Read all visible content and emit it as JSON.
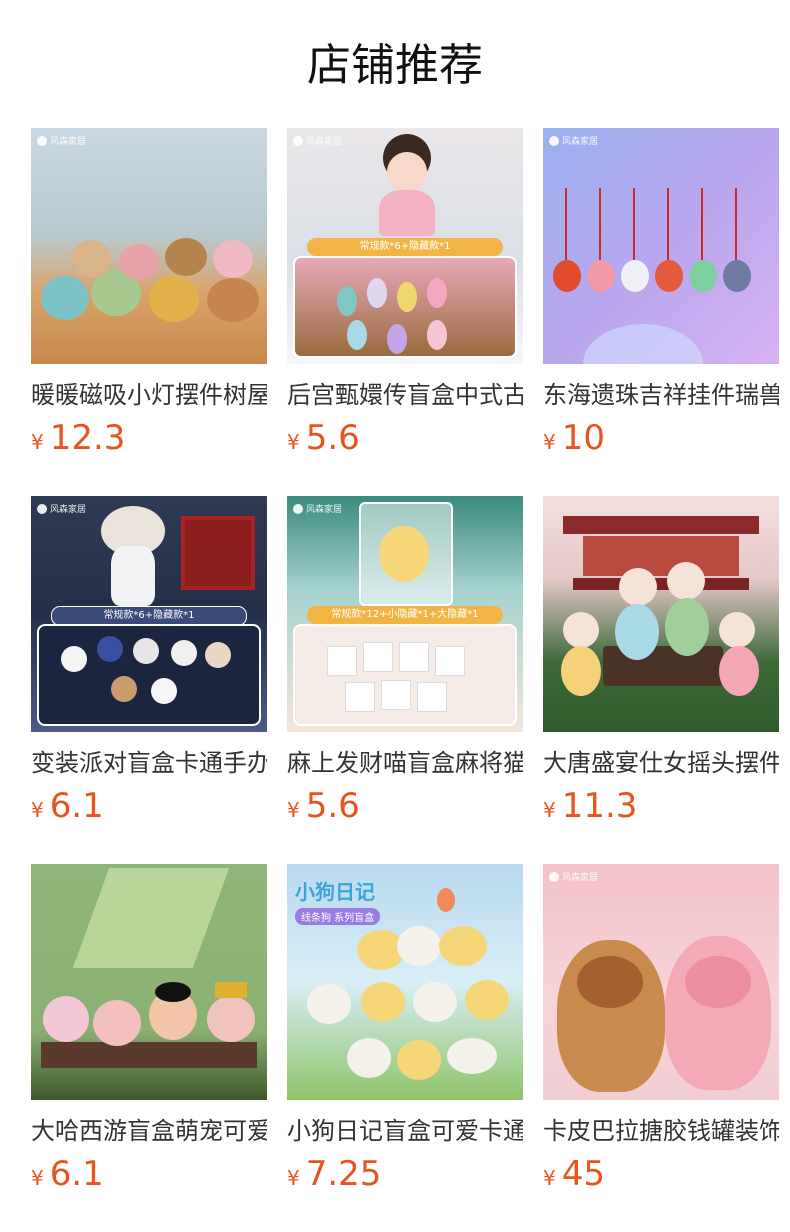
{
  "header": {
    "title": "店铺推荐"
  },
  "currency_symbol": "¥",
  "products": [
    {
      "name": "暖暖磁吸小灯摆件树屋",
      "price": "12.3",
      "thumb_icon": "nightlight-figures-image"
    },
    {
      "name": "后宫甄嬛传盲盒中式古风",
      "price": "5.6",
      "thumb_icon": "palace-figure-image",
      "banner": "常规款*6+隐藏款*1"
    },
    {
      "name": "东海遗珠吉祥挂件瑞兽",
      "price": "10",
      "thumb_icon": "lion-keychain-image"
    },
    {
      "name": "变装派对盲盒卡通手办",
      "price": "6.1",
      "thumb_icon": "costume-party-image",
      "banner": "常规款*6+隐藏款*1"
    },
    {
      "name": "麻上发财喵盲盒麻将猫",
      "price": "5.6",
      "thumb_icon": "lucky-cat-image",
      "banner": "常规款*12+小隐藏*1+大隐藏*1"
    },
    {
      "name": "大唐盛宴仕女摇头摆件",
      "price": "11.3",
      "thumb_icon": "tang-ladies-image"
    },
    {
      "name": "大哈西游盲盒萌宠可爱",
      "price": "6.1",
      "thumb_icon": "journey-west-image"
    },
    {
      "name": "小狗日记盲盒可爱卡通",
      "price": "7.25",
      "thumb_icon": "puppy-diary-image",
      "caption": "小狗日记",
      "subcaption": "线条狗 系列盲盒"
    },
    {
      "name": "卡皮巴拉搪胶钱罐装饰",
      "price": "45",
      "thumb_icon": "capybara-bank-image"
    }
  ],
  "brand_logo": "风森家居",
  "colors": {
    "price": "#e8541e",
    "title": "#111111",
    "name": "#333333"
  }
}
